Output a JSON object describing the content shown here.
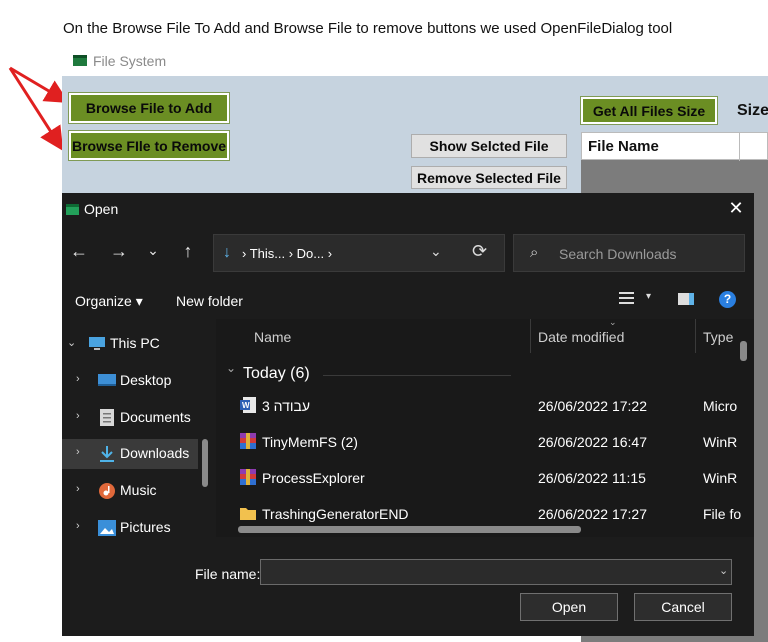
{
  "caption": "On the Browse File To Add and Browse File to remove buttons we used OpenFileDialog  tool",
  "app": {
    "title": "File System",
    "buttons": {
      "browse_add": "Browse File to Add",
      "browse_remove": "Browse FIle to Remove",
      "get_all_size": "Get All Files Size",
      "show_selected": "Show Selcted File",
      "remove_selected": "Remove Selected File"
    },
    "size_label": "Size",
    "grid_header": "File Name"
  },
  "dialog": {
    "title": "Open",
    "close_glyph": "✕",
    "nav": {
      "back": "←",
      "forward": "→",
      "recent": "⌄",
      "up": "↑",
      "address_icon": "↓",
      "address_path": "› This... › Do... ›",
      "address_dropdown": "⌄",
      "refresh": "⟳",
      "search_icon": "⌕",
      "search_placeholder": "Search Downloads"
    },
    "commands": {
      "organize": "Organize ▾",
      "new_folder": "New folder",
      "view_caret": "▾",
      "help": "?"
    },
    "tree": [
      {
        "label": "This PC",
        "chevron": "⌄",
        "icon": "pc-icon"
      },
      {
        "label": "Desktop",
        "chevron": "›",
        "icon": "desktop-icon"
      },
      {
        "label": "Documents",
        "chevron": "›",
        "icon": "documents-icon"
      },
      {
        "label": "Downloads",
        "chevron": "›",
        "icon": "downloads-icon",
        "selected": true
      },
      {
        "label": "Music",
        "chevron": "›",
        "icon": "music-icon"
      },
      {
        "label": "Pictures",
        "chevron": "›",
        "icon": "pictures-icon"
      }
    ],
    "columns": {
      "name": "Name",
      "date": "Date modified",
      "type": "Type",
      "sort_caret": "⌄"
    },
    "group": {
      "label": "Today (6)",
      "chevron": "⌄"
    },
    "files": [
      {
        "name": "עבודה 3",
        "date": "26/06/2022 17:22",
        "type": "Micro",
        "icon": "word-doc-icon"
      },
      {
        "name": "TinyMemFS (2)",
        "date": "26/06/2022 16:47",
        "type": "WinR",
        "icon": "winrar-archive-icon"
      },
      {
        "name": "ProcessExplorer",
        "date": "26/06/2022 11:15",
        "type": "WinR",
        "icon": "winrar-archive-icon"
      },
      {
        "name": "TrashingGeneratorEND",
        "date": "26/06/2022 17:27",
        "type": "File fo",
        "icon": "folder-icon"
      }
    ],
    "filename_label": "File name:",
    "filename_value": "",
    "filename_dropdown": "⌄",
    "open_label": "Open",
    "cancel_label": "Cancel"
  },
  "colors": {
    "app_bg": "#c6d3df",
    "green_button": "#6b8e23",
    "dialog_bg": "#202020",
    "arrow": "#e02020"
  }
}
